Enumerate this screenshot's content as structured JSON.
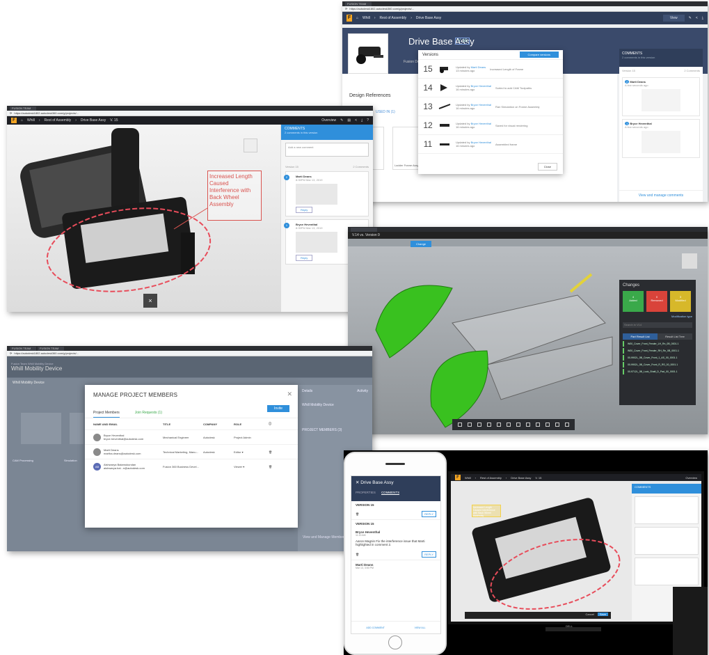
{
  "shot_a": {
    "tab": "FUSION TEAM",
    "url": "https://autodesk1802.autodesk360.com/g/projects/...",
    "breadcrumb": [
      "Whill",
      "Rest of Assembly",
      "Drive Base Assy"
    ],
    "view_label": "View",
    "title": "Drive Base Assy",
    "version_badge": "V. 15",
    "subtitle": "Fusion Design",
    "section": "Design References",
    "refs_tab": "USED IN (1)",
    "card_label": "Ladder Frame Assy",
    "versions_popup": {
      "title": "Versions",
      "compare_button": "Compare versions",
      "close_button": "Close",
      "rows": [
        {
          "num": "15",
          "prefix": "Updated by",
          "who": "Marti Deans",
          "note": "Increased Length of Frame",
          "ago": "13 minutes ago"
        },
        {
          "num": "14",
          "prefix": "Updated by",
          "who": "Bryce Heventhal",
          "note": "Sorted to add CAM Toolpaths",
          "ago": "16 minutes ago"
        },
        {
          "num": "13",
          "prefix": "Updated by",
          "who": "Bryce Heventhal",
          "note": "Ran Simulation on Frame Assembly",
          "ago": "16 minutes ago"
        },
        {
          "num": "12",
          "prefix": "Updated by",
          "who": "Bryce Heventhal",
          "note": "Saved for visual rendering",
          "ago": "16 minutes ago"
        },
        {
          "num": "11",
          "prefix": "Updated by",
          "who": "Bryce Heventhal",
          "note": "Assembled frame",
          "ago": "16 minutes ago"
        }
      ]
    },
    "comments": {
      "title": "COMMENTS",
      "subtitle": "2 comments in this version",
      "version_label": "Version 15",
      "count_label": "2 Comments",
      "items": [
        {
          "num": "2",
          "name": "Marti Deans",
          "date": "A few seconds ago"
        },
        {
          "num": "1",
          "name": "Bryce Heventhal",
          "date": "A few seconds ago"
        }
      ],
      "manage_link": "View and manage comments"
    }
  },
  "shot_b": {
    "tab": "FUSION TEAM",
    "url": "https://autodesk1802.autodesk360.com/g/projects/...",
    "breadcrumb": [
      "Whill",
      "Rest of Assembly",
      "Drive Base Assy",
      "V. 15"
    ],
    "overview_label": "Overview",
    "markup_text": "Increased Length Caused Interference with Back Wheel Assembly",
    "close_glyph": "×",
    "comments": {
      "title": "COMMENTS",
      "subtitle": "2 comments in this version",
      "add_placeholder": "Add a new comment",
      "version_label": "Version 15",
      "count_label": "2 Comments",
      "items": [
        {
          "num": "2",
          "name": "Marti Deans",
          "date": "8:35PM Mar 13, 2019",
          "reply": "Reply"
        },
        {
          "num": "1",
          "name": "Bryce Heventhal",
          "date": "8:35PM Mar 13, 2019",
          "reply": "Reply"
        }
      ]
    }
  },
  "shot_c": {
    "change_button": "Change",
    "version_label": "V.14 vs. Version 9",
    "panel_title": "Changes",
    "tiles": [
      {
        "label": "Added",
        "count": "4",
        "color": "#3aa94a"
      },
      {
        "label": "Removed",
        "count": "0",
        "color": "#d9433a"
      },
      {
        "label": "Modified",
        "count": "3",
        "color": "#d7b82a"
      }
    ],
    "modification_type": "Modification type",
    "tabs": [
      "Part Result List",
      "Result List Tree"
    ],
    "search_placeholder": "Search in V14",
    "list": [
      "W00_Cover_Front_Fender_LH_Rn_0B_0001.1",
      "W00_Cover_Front_Fender_RH_Rn_0B_0001.1",
      "00-9902L_0B_Cover_Front_1_AS_00_0001.1",
      "00-9902L_0B_Cover_Front_R_RS_00_0001.1",
      "00-9712L_0B_Lock_Shaft_D_Pad_00_0001.1"
    ]
  },
  "shot_d": {
    "tabs": [
      "FUSION TEAM",
      "FUSION TEAM"
    ],
    "url": "https://autodesk1802.autodesk360.com/g/projects/...",
    "hub": "Fusion Team Whill Mobility Device",
    "project": "Whill Mobility Device",
    "crumb": "Whill Mobility Device",
    "side_tabs": [
      "Details",
      "Activity"
    ],
    "side_project": "Whill Mobility Device",
    "side_members": "PROJECT MEMBERS (3)",
    "folders": [
      "CAM Processing",
      "Simulation"
    ],
    "modal": {
      "title": "MANAGE PROJECT MEMBERS",
      "close": "✕",
      "tabs": [
        "Project Members",
        "Join Requests (1)"
      ],
      "invite_button": "Invite",
      "headers": [
        "NAME AND EMAIL",
        "TITLE",
        "COMPANY",
        "ROLE"
      ],
      "rows": [
        {
          "initials": "",
          "name": "Bryce Heventhal",
          "email": "bryce.heventhal@autodesk.com",
          "title": "Mechanical Engineer",
          "company": "Autodesk",
          "role": "Project Admin"
        },
        {
          "initials": "",
          "name": "Marti Deans",
          "email": "martha.deans@autodesk.com",
          "title": "Technical Marketing, Manu...",
          "company": "Autodesk",
          "role": "Editor"
        },
        {
          "initials": "AB",
          "name": "Aishwarya Balamukundan",
          "email": "aishwarya.bal...n@autodesk.com",
          "title": "Fusion 360 Business Devel...",
          "company": "",
          "role": "Viewer"
        }
      ],
      "view_manage": "View and Manage Members"
    }
  },
  "shot_e": {
    "phone": {
      "title": "Drive Base Assy",
      "tabs": [
        "PROPERTIES",
        "COMMENTS"
      ],
      "version_a": "VERSION 15",
      "reply_a": "REPLY",
      "version_b": "VERSION 15",
      "comment_name": "Bryce Heventhal",
      "comment_date": "11:19 AM",
      "comment_text": "Aaron Magnin Fix the interference issue that Marti highlighted in comment 2.",
      "reply_b": "REPLY",
      "comment2_name": "Marti Deans",
      "comment2_date": "Mar 13, 3:50 PM",
      "footer": [
        "ADD COMMENT",
        "VIEW ALL"
      ]
    },
    "monitor": {
      "breadcrumb": [
        "Whill",
        "Rest of Assembly",
        "Drive Base Assy",
        "V. 15"
      ],
      "overview_label": "Overview",
      "panel_title": "COMMENTS",
      "markup_text": "Increased Length Caused Interference with Back Wheel Assembly",
      "brand": "DELL",
      "cancel": "Cancel",
      "save": "Save"
    }
  }
}
